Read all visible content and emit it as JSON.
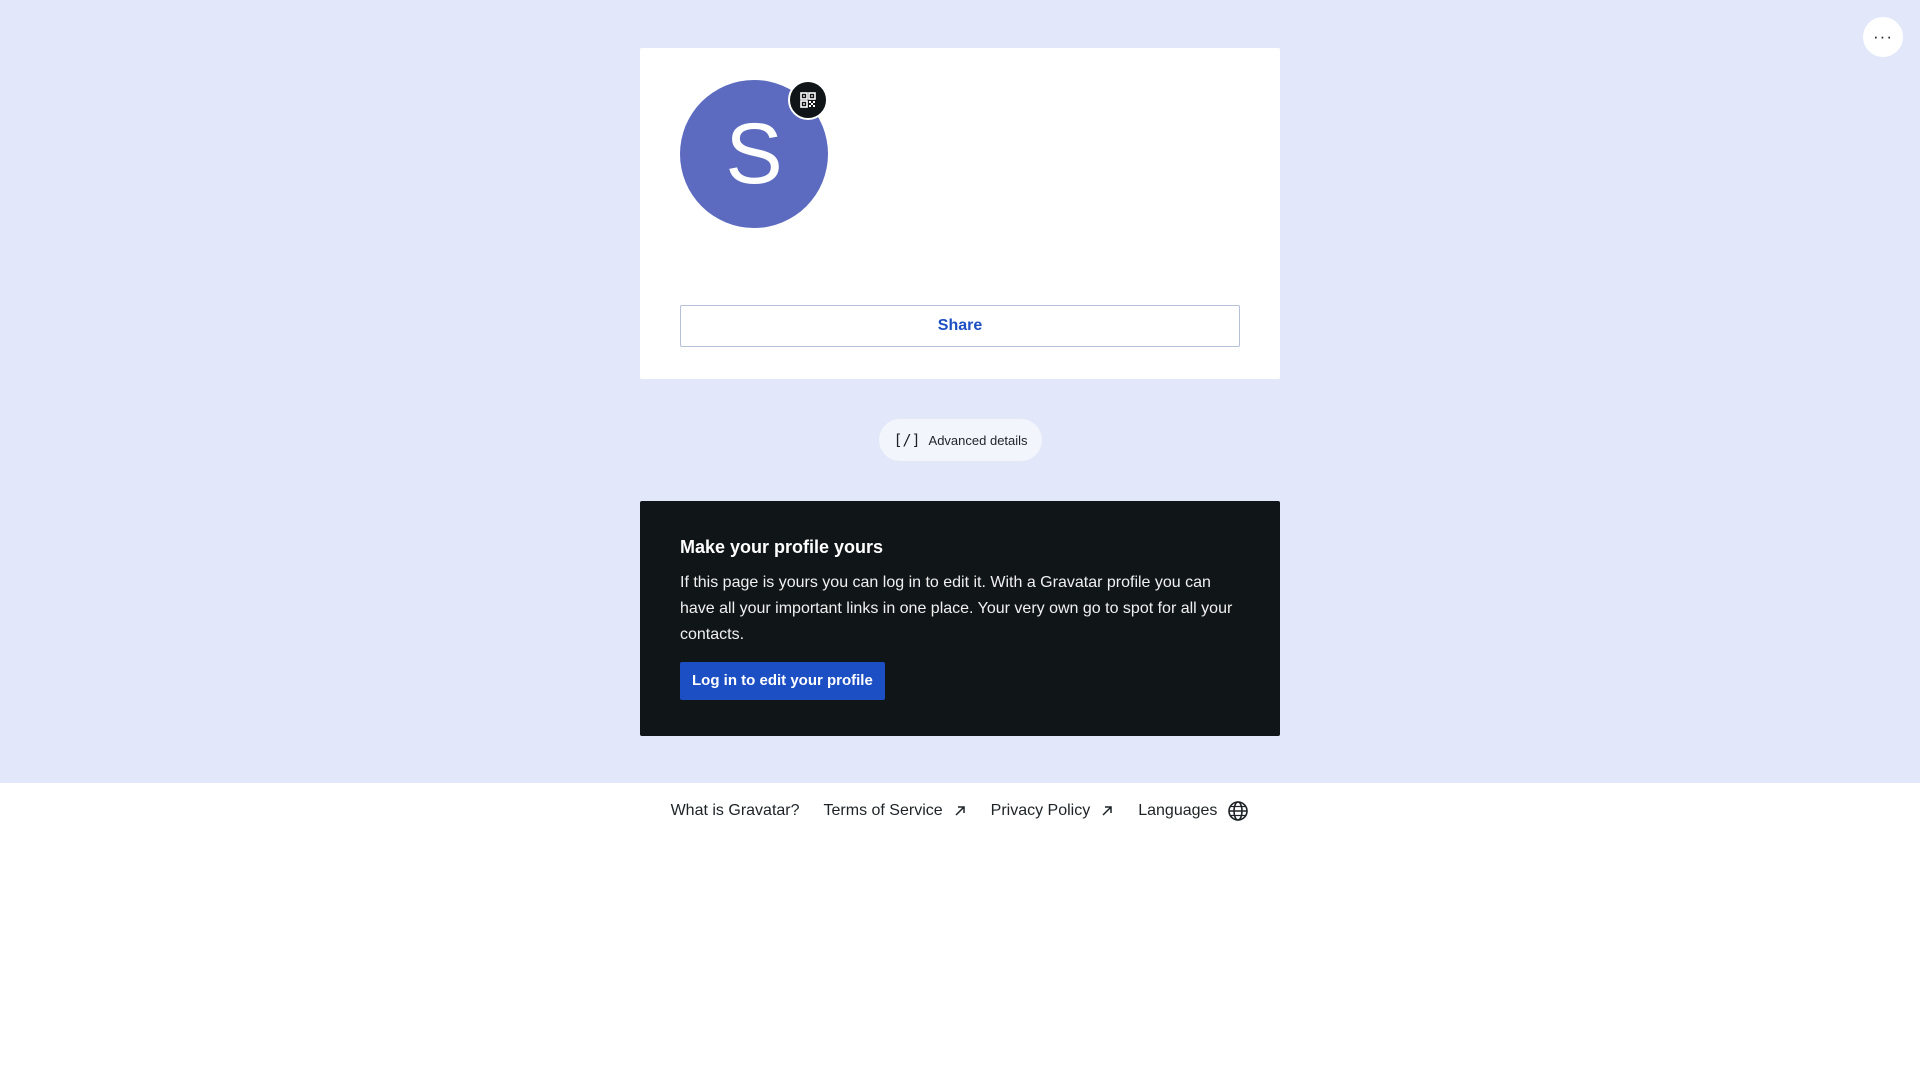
{
  "menu": {
    "icon": "more-horizontal-icon",
    "label": "···"
  },
  "profile": {
    "avatar_initial": "S",
    "avatar_color": "#5c6bc0",
    "qr_icon": "qr-code-icon",
    "share_label": "Share"
  },
  "advanced": {
    "icon_text": "[/]",
    "label": "Advanced details"
  },
  "claim": {
    "title": "Make your profile yours",
    "body": "If this page is yours you can log in to edit it. With a Gravatar profile you can have all your important links in one place. Your very own go to spot for all your contacts.",
    "button_label": "Log in to edit your profile"
  },
  "footer": {
    "links": [
      {
        "label": "What is Gravatar?"
      },
      {
        "label": "Terms of Service",
        "icon": "external-link-icon"
      },
      {
        "label": "Privacy Policy",
        "icon": "external-link-icon"
      },
      {
        "label": "Languages",
        "icon": "globe-icon"
      }
    ]
  },
  "colors": {
    "page_background": "#e2e8f9",
    "accent": "#1d4fc4",
    "dark_card": "#101517"
  }
}
